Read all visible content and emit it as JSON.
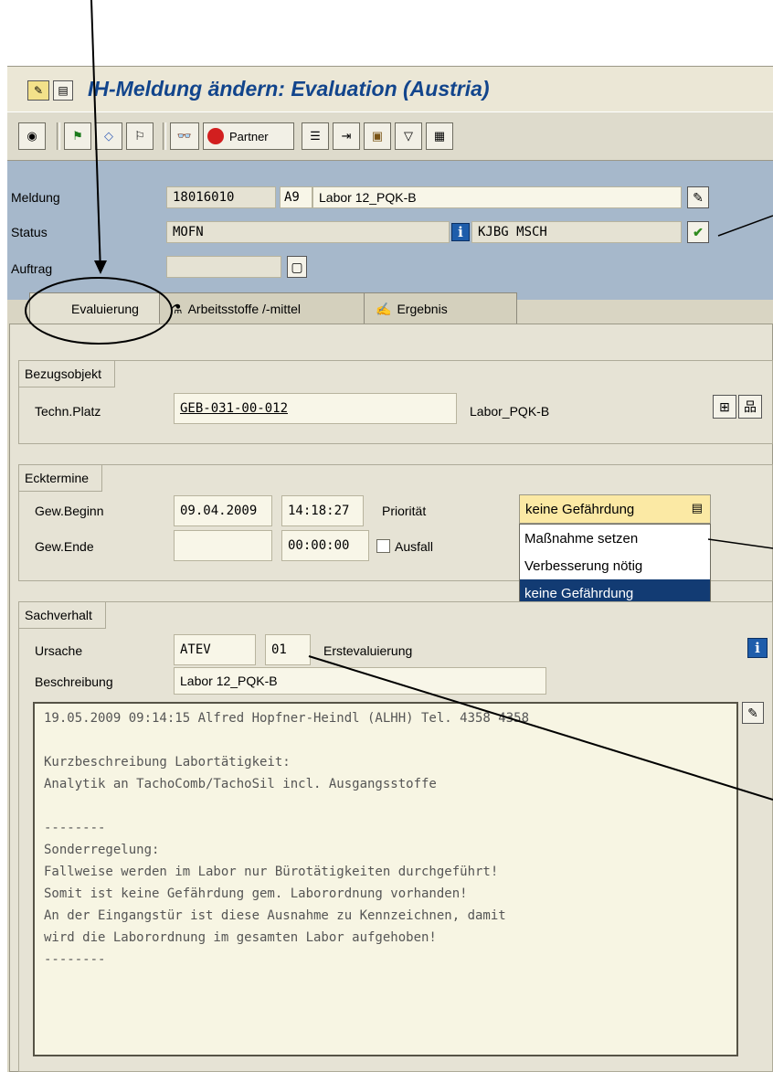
{
  "window": {
    "title": "IH-Meldung ändern: Evaluation (Austria)"
  },
  "toolbar": {
    "partner_label": "Partner"
  },
  "header": {
    "meldung_label": "Meldung",
    "meldung_number": "18016010",
    "meldung_art": "A9",
    "meldung_text": "Labor 12_PQK-B",
    "status_label": "Status",
    "status_value": "MOFN",
    "status_user": "KJBG MSCH",
    "auftrag_label": "Auftrag",
    "auftrag_value": ""
  },
  "tabs": [
    {
      "label": "Evaluierung",
      "active": true
    },
    {
      "label": "Arbeitsstoffe /-mittel",
      "active": false
    },
    {
      "label": "Ergebnis",
      "active": false
    }
  ],
  "bezugsobjekt": {
    "title": "Bezugsobjekt",
    "label": "Techn.Platz",
    "value": "GEB-031-00-012",
    "description": "Labor_PQK-B"
  },
  "ecktermine": {
    "title": "Ecktermine",
    "beginn_label": "Gew.Beginn",
    "beginn_date": "09.04.2009",
    "beginn_time": "14:18:27",
    "ende_label": "Gew.Ende",
    "ende_date": "",
    "ende_time": "00:00:00",
    "ausfall_label": "Ausfall",
    "prioritaet_label": "Priorität",
    "prioritaet_value": "keine Gefährdung",
    "prioritaet_options": [
      "Maßnahme setzen",
      "Verbesserung nötig",
      "keine Gefährdung"
    ]
  },
  "sachverhalt": {
    "title": "Sachverhalt",
    "ursache_label": "Ursache",
    "ursache_code": "ATEV",
    "ursache_num": "01",
    "ursache_text": "Erstevaluierung",
    "beschreibung_label": "Beschreibung",
    "beschreibung_value": "Labor 12_PQK-B",
    "longtext": [
      "19.05.2009 09:14:15 Alfred Hopfner-Heindl (ALHH) Tel. 4358 4358",
      "",
      "Kurzbeschreibung Labortätigkeit:",
      "Analytik an TachoComb/TachoSil incl. Ausgangsstoffe",
      "",
      "--------",
      "Sonderregelung:",
      "Fallweise werden im Labor nur Bürotätigkeiten durchgeführt!",
      "Somit ist keine Gefährdung gem. Laborordnung vorhanden!",
      "An der Eingangstür ist diese Ausnahme zu Kennzeichnen, damit",
      "wird die Laborordnung im gesamten Labor aufgehoben!",
      "--------"
    ]
  },
  "colors": {
    "title_blue": "#12458c",
    "header_blue": "#a6b8cb",
    "selection": "#123b73",
    "dropdown_yellow": "#fbe9a4"
  }
}
